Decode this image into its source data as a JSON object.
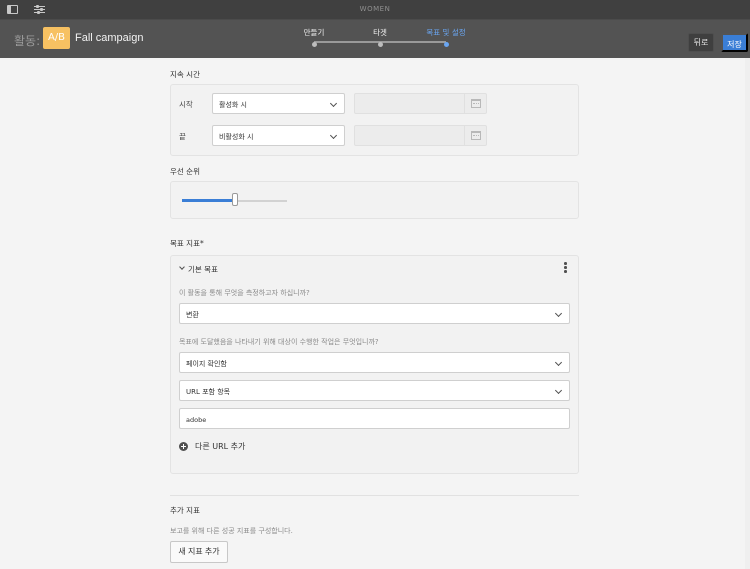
{
  "topbar": {
    "title": "WOMEN",
    "icons": [
      "panel-toggle-icon",
      "settings-sliders-icon"
    ]
  },
  "header": {
    "activity_label": "활동:",
    "badge": "A/B",
    "campaign_name": "Fall campaign",
    "steps": [
      {
        "label": "만들기",
        "state": "done"
      },
      {
        "label": "타겟",
        "state": "done"
      },
      {
        "label": "목표 및 설정",
        "state": "active"
      }
    ],
    "back_label": "뒤로",
    "save_label": "저장",
    "colors": {
      "accent": "#3a7ed6",
      "badge": "#f7c162",
      "active_step": "#6aa6f2"
    }
  },
  "duration": {
    "title": "지속 시간",
    "start": {
      "label": "시작",
      "value": "활성화 시",
      "date": ""
    },
    "end": {
      "label": "끝",
      "value": "비활성화 시",
      "date": ""
    }
  },
  "priority": {
    "title": "우선 순위",
    "level": 0.5
  },
  "goal_metric": {
    "title": "목표 지표*",
    "primary": {
      "heading": "기본 목표",
      "question1": "이 활동을 통해 무엇을 측정하고자 하십니까?",
      "metric": "변환",
      "question2": "목표에 도달했음을 나타내기 위해 대상이 수행한 작업은 무엇입니까?",
      "action": "페이지 확인함",
      "url_condition": "URL 포함 항목",
      "url_value": "adobe",
      "add_url_label": "다른 URL 추가"
    }
  },
  "additional_metrics": {
    "title": "추가 지표",
    "helper": "보고를 위해 다른 성공 지표를 구성합니다.",
    "add_button": "새 지표 추가"
  }
}
